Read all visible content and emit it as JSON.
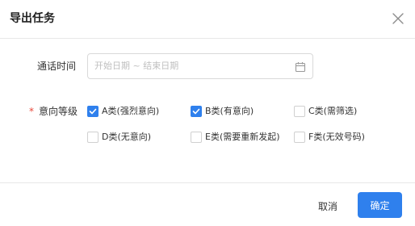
{
  "dialog": {
    "title": "导出任务",
    "close_icon": "close-icon"
  },
  "form": {
    "call_time": {
      "label": "通话时间",
      "placeholder": "开始日期 ~ 结束日期",
      "icon": "calendar-icon"
    },
    "intent_level": {
      "required_mark": "*",
      "label": "意向等级",
      "options": [
        {
          "label": "A类(强烈意向)",
          "checked": true
        },
        {
          "label": "B类(有意向)",
          "checked": true
        },
        {
          "label": "C类(需筛选)",
          "checked": false
        },
        {
          "label": "D类(无意向)",
          "checked": false
        },
        {
          "label": "E类(需要重新发起)",
          "checked": false
        },
        {
          "label": "F类(无效号码)",
          "checked": false
        }
      ]
    }
  },
  "footer": {
    "cancel_label": "取消",
    "ok_label": "确定"
  },
  "colors": {
    "primary": "#2f80ed",
    "required": "#e8473a",
    "placeholder": "#bfbfbf",
    "border": "#d9d9d9"
  }
}
